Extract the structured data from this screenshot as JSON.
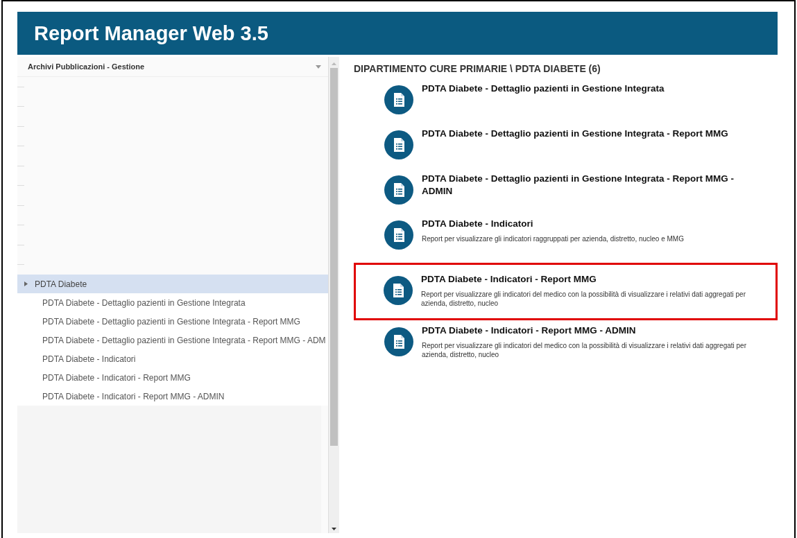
{
  "header": {
    "title": "Report Manager Web 3.5"
  },
  "sidebar": {
    "title": "Archivi Pubblicazioni - Gestione",
    "tree": [
      {
        "label": "PDTA Diabete",
        "selected": true,
        "expanded": true,
        "children": [
          {
            "label": "PDTA Diabete - Dettaglio pazienti in Gestione Integrata",
            "selected": false
          },
          {
            "label": "PDTA Diabete - Dettaglio pazienti in Gestione Integrata - Report MMG",
            "selected": false
          },
          {
            "label": "PDTA Diabete - Dettaglio pazienti in Gestione Integrata - Report MMG - ADM",
            "selected": false
          },
          {
            "label": "PDTA Diabete - Indicatori",
            "selected": false
          },
          {
            "label": "PDTA Diabete - Indicatori - Report MMG",
            "selected": false
          },
          {
            "label": "PDTA Diabete - Indicatori - Report MMG - ADMIN",
            "selected": false
          }
        ]
      }
    ]
  },
  "content": {
    "breadcrumb": "DIPARTIMENTO CURE PRIMARIE \\ PDTA DIABETE (6)",
    "reports": [
      {
        "title": "PDTA Diabete - Dettaglio pazienti in Gestione Integrata",
        "highlighted": false
      },
      {
        "title": "PDTA Diabete - Dettaglio pazienti in Gestione Integrata - Report MMG",
        "highlighted": false
      },
      {
        "title": "PDTA Diabete - Dettaglio pazienti in Gestione Integrata - Report MMG - ADMIN",
        "highlighted": false
      },
      {
        "title": "PDTA Diabete - Indicatori",
        "description": "Report per visualizzare gli indicatori raggruppati per azienda, distretto, nucleo e MMG",
        "highlighted": false
      },
      {
        "title": "PDTA Diabete - Indicatori - Report MMG",
        "description": "Report per visualizzare gli indicatori del medico con la possibilità di visualizzare i relativi dati aggregati per azienda, distretto, nucleo",
        "highlighted": true
      },
      {
        "title": "PDTA Diabete - Indicatori - Report MMG - ADMIN",
        "description": "Report per visualizzare gli indicatori del medico con la possibilità di visualizzare i relativi dati aggregati per azienda, distretto, nucleo",
        "highlighted": false
      }
    ]
  }
}
